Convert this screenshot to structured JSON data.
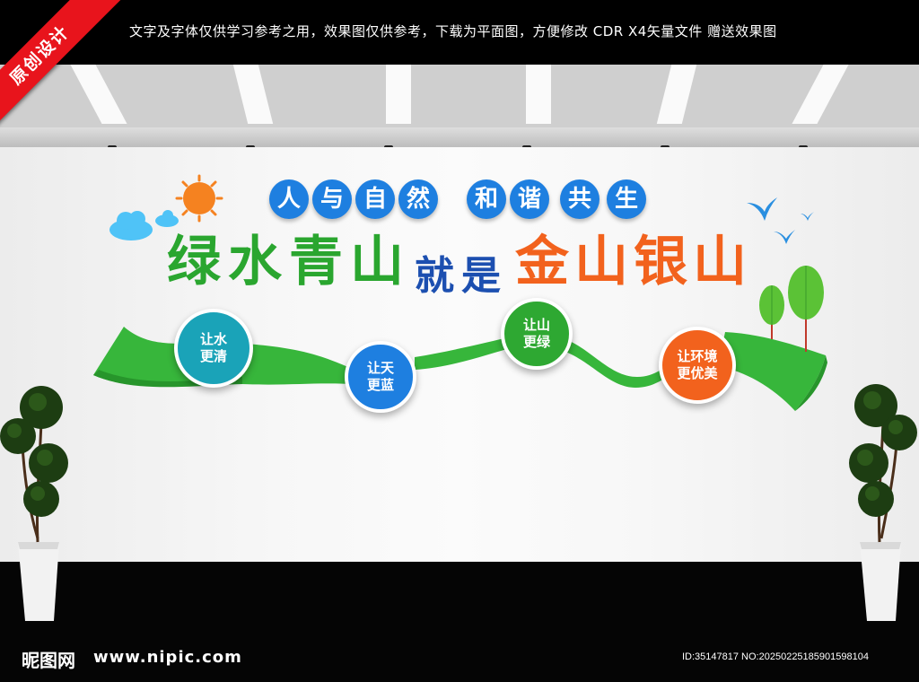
{
  "banner": {
    "text": "文字及字体仅供学习参考之用，效果图仅供参考，下载为平面图，方便修改    CDR X4矢量文件  赠送效果图",
    "corner_label": "原创设计"
  },
  "title_line": {
    "group1": [
      "人",
      "与",
      "自",
      "然"
    ],
    "group2": [
      "和",
      "谐",
      "共",
      "生"
    ]
  },
  "main_slogan": {
    "green": [
      "绿",
      "水",
      "青",
      "山"
    ],
    "blue": [
      "就",
      "是"
    ],
    "orange": [
      "金",
      "山",
      "银",
      "山"
    ]
  },
  "discs": [
    {
      "lines": [
        "让水",
        "更清"
      ],
      "color": "#1aa3b8"
    },
    {
      "lines": [
        "让天",
        "更蓝"
      ],
      "color": "#1e7fe0"
    },
    {
      "lines": [
        "让山",
        "更绿"
      ],
      "color": "#2ea832"
    },
    {
      "lines": [
        "让环境",
        "更优美"
      ],
      "color": "#f2621d"
    }
  ],
  "colors": {
    "green": "#2aa62f",
    "blue": "#1e7fe0",
    "orange": "#f2621d",
    "sun": "#f58220",
    "sky": "#4fc3f7"
  },
  "footer": {
    "logo": "昵图网",
    "url": "www.nipic.com",
    "id": "ID:35147817 NO:20250225185901598104"
  }
}
